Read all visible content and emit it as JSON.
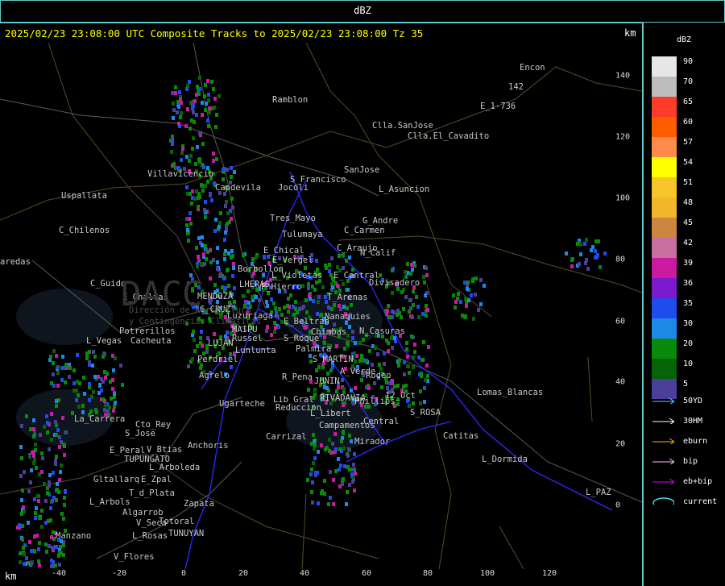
{
  "header": {
    "product": "dBZ"
  },
  "map": {
    "title": "2025/02/23 23:08:00 UTC Composite Tracks to 2025/02/23 23:08:00 Tz 35",
    "km_label": "km",
    "x_ticks": [
      "-40",
      "-20",
      "0",
      "20",
      "40",
      "60",
      "80",
      "100",
      "120"
    ],
    "y_ticks": [
      "140",
      "120",
      "100",
      "80",
      "60",
      "40",
      "20",
      "0"
    ],
    "places": [
      "Ramblon",
      "Encon",
      "E_1-736",
      "142",
      "Clla.SanJose",
      "Clla.El_Cavadito",
      "Villavicencio",
      "S_Francisco",
      "SanJose",
      "Uspallata",
      "Capdevila",
      "Jocoli",
      "L_Asuncion",
      "Tres_Mayo",
      "G_Andre",
      "C_Chilenos",
      "Tulumaya",
      "C_Carmen",
      "E_Chical",
      "E_Vergel",
      "C_Araujo",
      "N_Calif",
      "aredas",
      "Borbollon",
      "L_Violetas",
      "E_Central",
      "C_Guido",
      "P_Hierro",
      "Divisadero",
      "E_Chaltas",
      "MENDOZA",
      "LHERAS",
      "T_Arenas",
      "G_CRUZ",
      "Luzuriaga",
      "Nanaquies",
      "Potrerillos",
      "MAIPU",
      "E_Beltran",
      "N_Casuras",
      "L_Vegas",
      "Cacheuta",
      "Russel",
      "Chimbas",
      "S_Roque",
      "LUJAN",
      "Lunlunta",
      "Palmira",
      "Perdriel",
      "S_MARTIN",
      "A_Verde",
      "Agrelo",
      "R_Pena",
      "JUNIN",
      "Rodeo",
      "Lomas_Blancas",
      "RIVADAVIA",
      "Phillips",
      "12_Oct",
      "Ugarteche",
      "Reduccion",
      "Lib_Gral",
      "L_Libert",
      "S_ROSA",
      "La_Carrera",
      "Cto_Rey",
      "Campamentos",
      "Central",
      "S_Jose",
      "Carrizal",
      "Mirador",
      "Catitas",
      "E_Peral",
      "V_Btias",
      "Anchoris",
      "TUPUNGATO",
      "L_Dormida",
      "L_Arboleda",
      "Gltallarq",
      "E_Zpal",
      "L_PAZ",
      "T_d_Plata",
      "L_Arbols",
      "Zapata",
      "Algarrob",
      "Totoral",
      "V_Seca",
      "L_Rosas",
      "Manzano",
      "TUNUYAN",
      "V_Flores",
      "DACC",
      "Dirección de Agricultura",
      "y Contingencias Climáticas"
    ]
  },
  "legend": {
    "title": "dBZ",
    "scale": [
      {
        "label": "90",
        "color": "#e6e6e6"
      },
      {
        "label": "70",
        "color": "#bdbdbd"
      },
      {
        "label": "65",
        "color": "#ff3b2a"
      },
      {
        "label": "60",
        "color": "#ff5c00"
      },
      {
        "label": "57",
        "color": "#ff8a4a"
      },
      {
        "label": "54",
        "color": "#ffff00"
      },
      {
        "label": "51",
        "color": "#f7c42a"
      },
      {
        "label": "48",
        "color": "#f2b62c"
      },
      {
        "label": "45",
        "color": "#cd853f"
      },
      {
        "label": "42",
        "color": "#c86ea0"
      },
      {
        "label": "39",
        "color": "#cc1aa0"
      },
      {
        "label": "36",
        "color": "#7a1acc"
      },
      {
        "label": "35",
        "color": "#1f4bef"
      },
      {
        "label": "30",
        "color": "#1e88e5"
      },
      {
        "label": "20",
        "color": "#0a8a0a"
      },
      {
        "label": "10",
        "color": "#066406"
      },
      {
        "label": "5",
        "color": "#4a3f9a"
      }
    ],
    "tracks": [
      {
        "label": "50YD",
        "color": "#4fd7ff"
      },
      {
        "label": "30HM",
        "color": "#ffffff"
      },
      {
        "label": "eburn",
        "color": "#ffb000"
      },
      {
        "label": "bip",
        "color": "#ffc0ff"
      },
      {
        "label": "eb+bip",
        "color": "#e000ff"
      },
      {
        "label": "current",
        "color": "#4fd7ff"
      }
    ]
  }
}
